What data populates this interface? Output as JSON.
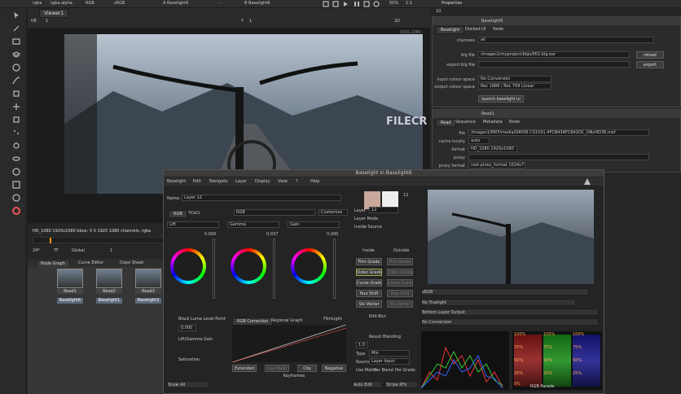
{
  "toolbar": {
    "channels": "rgba",
    "alpha": "rgba.alpha",
    "colorspace_short": "RGB",
    "display": "sRGB",
    "grade_a": "A  Baselight6",
    "wipe_mode": "-",
    "grade_b": "B  Baselight6",
    "zoom": "50%",
    "ratio": "1:1",
    "properties_title": "Properties",
    "properties_count": "10"
  },
  "viewer": {
    "tab": "Viewer1",
    "fstop": "f/8",
    "fstop_value": "1",
    "y_label": "Y",
    "y_value": "1",
    "mode": "2D",
    "res_label": "1920,1080",
    "info": "HD_1080 1920x1080  bbox: 0 0 1920 1080 channels: rgba"
  },
  "timeline": {
    "fps": "24*",
    "tf": "TF",
    "range": "Global",
    "frame": "1"
  },
  "node_graph": {
    "tabs": [
      "Node Graph",
      "Curve Editor",
      "Dope Sheet"
    ],
    "nodes": [
      "Read1",
      "Read2",
      "Read3"
    ],
    "baselight": [
      "Baselight6",
      "Baselight1",
      "Baselight3"
    ]
  },
  "properties": {
    "node_title": "Baselight6",
    "node_tabs": [
      "Baselight",
      "Docked UI",
      "Node"
    ],
    "channels_label": "channels",
    "channels_value": "all",
    "blg_label": "blg file",
    "blg_value": "/images1/myproject/blgs/002.blg.exr",
    "reload": "reload",
    "export_label": "export blg file",
    "export": "export",
    "input_cs_label": "input colour space",
    "input_cs_value": "No Conversion",
    "output_cs_label": "output colour space",
    "output_cs_value": "Rec 1886 / Rec 709 Linear",
    "launch": "launch baselight ui",
    "read_title": "Read1",
    "read_tabs": [
      "Read",
      "Sequence",
      "Metadata",
      "Node"
    ],
    "file_label": "file",
    "file_value": "/images1/MXF/media/DAY06 CS1V01.4FCB434FCB42DC_DNxHD36.mxf",
    "local_label": "cache locally",
    "local_value": "auto",
    "format_label": "format",
    "format_value": "HD_1080 1920x1080",
    "proxy_label": "proxy",
    "proxy_fmt_label": "proxy format",
    "proxy_fmt_value": "root.proxy_format 1024x778"
  },
  "baselight": {
    "window_title": "Baselight in Baselight6",
    "menu": [
      "Baselight",
      "Edit",
      "Navigate",
      "Layer",
      "Display",
      "View",
      "?",
      "Help"
    ],
    "name_label": "Name:",
    "name_value": "Layer 12",
    "layer_count": "12",
    "tabs": [
      "RGB",
      "YCbCr"
    ],
    "mode": "RGB",
    "customise": "Customise",
    "wheels": [
      {
        "name": "Lift",
        "value": "0.000"
      },
      {
        "name": "Gamma",
        "value": "0.037"
      },
      {
        "name": "Gain",
        "value": "0.000"
      }
    ],
    "layer_label": "Layer",
    "layer_value": "12",
    "customise2": "Customise",
    "layer_mode_label": "Layer Mode",
    "inside_source_label": "Inside Source",
    "inside": "Inside",
    "outside": "Outside",
    "grades": [
      [
        "Film Grade",
        "Film Grade"
      ],
      [
        "Video Grade",
        "Video Grade"
      ],
      [
        "Curve Grade",
        "Curve Grade"
      ],
      [
        "Hue Shift",
        "Hue Shift"
      ],
      [
        "Six Vector",
        "Six Vector"
      ]
    ],
    "edit_blur": "Edit Blur",
    "result_blending": "Result Blending",
    "blend_value": "1.0",
    "type_label": "Type",
    "type_value": "Mix",
    "source_label": "Source",
    "source_value": "Layer Input",
    "use_mattes": "Use Matte",
    "per_blend": "Per Blend",
    "per_grade": "Per Grade",
    "black_level": "Black Luma Level Point",
    "black_value": "0.000",
    "lift_gain": "Lift/Gamma Gain",
    "saturation": "Saturation",
    "curve_tabs": [
      "RGB Correction",
      "Regional Graph"
    ],
    "film_light": "FilmLight",
    "extended": "Extended",
    "use_mask": "Use Mask",
    "clip": "Clip",
    "negative": "Negative",
    "keyframes": "Keyframes",
    "show_all": "Show All",
    "auto_edit": "Auto Edit",
    "stripe_kf": "Stripe KFs",
    "display": "sRGB",
    "truelight": "No Truelight",
    "bottom_layer": "Bottom Layer Output",
    "no_conversion": "No Conversion",
    "scope_labels": [
      "100%",
      "100%",
      "100%",
      "75%",
      "75%",
      "75%",
      "50%",
      "50%",
      "50%",
      "25%",
      "25%",
      "25%",
      "0%"
    ],
    "scope_footer": "RGB Parade"
  },
  "watermark": "FILECR"
}
